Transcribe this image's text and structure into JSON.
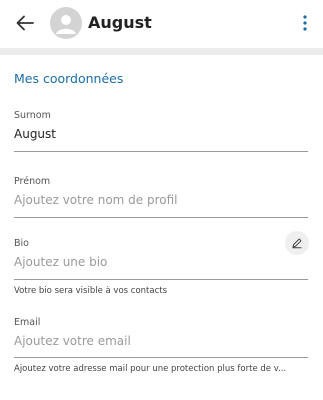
{
  "header": {
    "title": "August",
    "back_icon": "arrow-left-icon",
    "avatar_icon": "person-icon",
    "more_icon": "more-vertical-icon"
  },
  "section": {
    "title": "Mes coordonnées"
  },
  "fields": {
    "surnom": {
      "label": "Surnom",
      "value": "August"
    },
    "prenom": {
      "label": "Prénom",
      "placeholder": "Ajoutez votre nom de profil"
    },
    "bio": {
      "label": "Bio",
      "placeholder": "Ajoutez une bio",
      "helper": "Votre bio sera visible à vos contacts",
      "edit_icon": "pencil-icon"
    },
    "email": {
      "label": "Email",
      "placeholder": "Ajoutez votre email",
      "helper": "Ajoutez votre adresse mail pour une protection plus forte de v..."
    }
  },
  "colors": {
    "accent": "#1a6ea8",
    "icon": "#1a6ea8",
    "divider": "#ececec"
  }
}
